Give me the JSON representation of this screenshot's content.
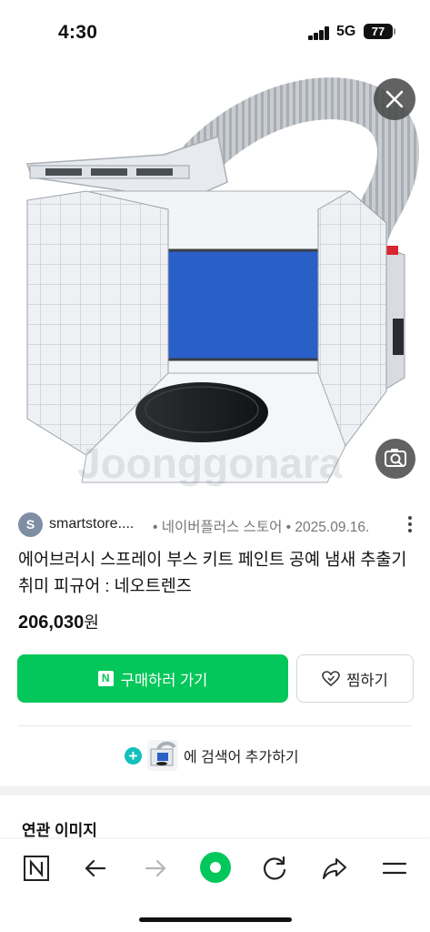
{
  "status": {
    "time": "4:30",
    "network": "5G",
    "battery": "77"
  },
  "hero": {
    "watermark": "Joonggonara"
  },
  "source": {
    "avatar_letter": "S",
    "name": "smartstore....",
    "meta": "• 네이버플러스 스토어 • 2025.09.16."
  },
  "product": {
    "title": "에어브러시 스프레이 부스 키트 페인트 공예 냄새 추출기 취미 피규어 : 네오트렌즈",
    "price": "206,030",
    "currency": "원"
  },
  "actions": {
    "buy_logo": "N",
    "buy_label": "구매하러 가기",
    "wish_label": "찜하기"
  },
  "add_search": {
    "label": "에 검색어 추가하기"
  },
  "related": {
    "title": "연관 이미지"
  },
  "colors": {
    "naver_green": "#03c75a",
    "teal": "#12c0bd",
    "filter_blue": "#2a5fc8"
  },
  "nav_icons": [
    "naver-n-icon",
    "back-arrow-icon",
    "forward-arrow-icon",
    "green-dot-home-icon",
    "reload-icon",
    "share-icon",
    "menu-icon"
  ]
}
